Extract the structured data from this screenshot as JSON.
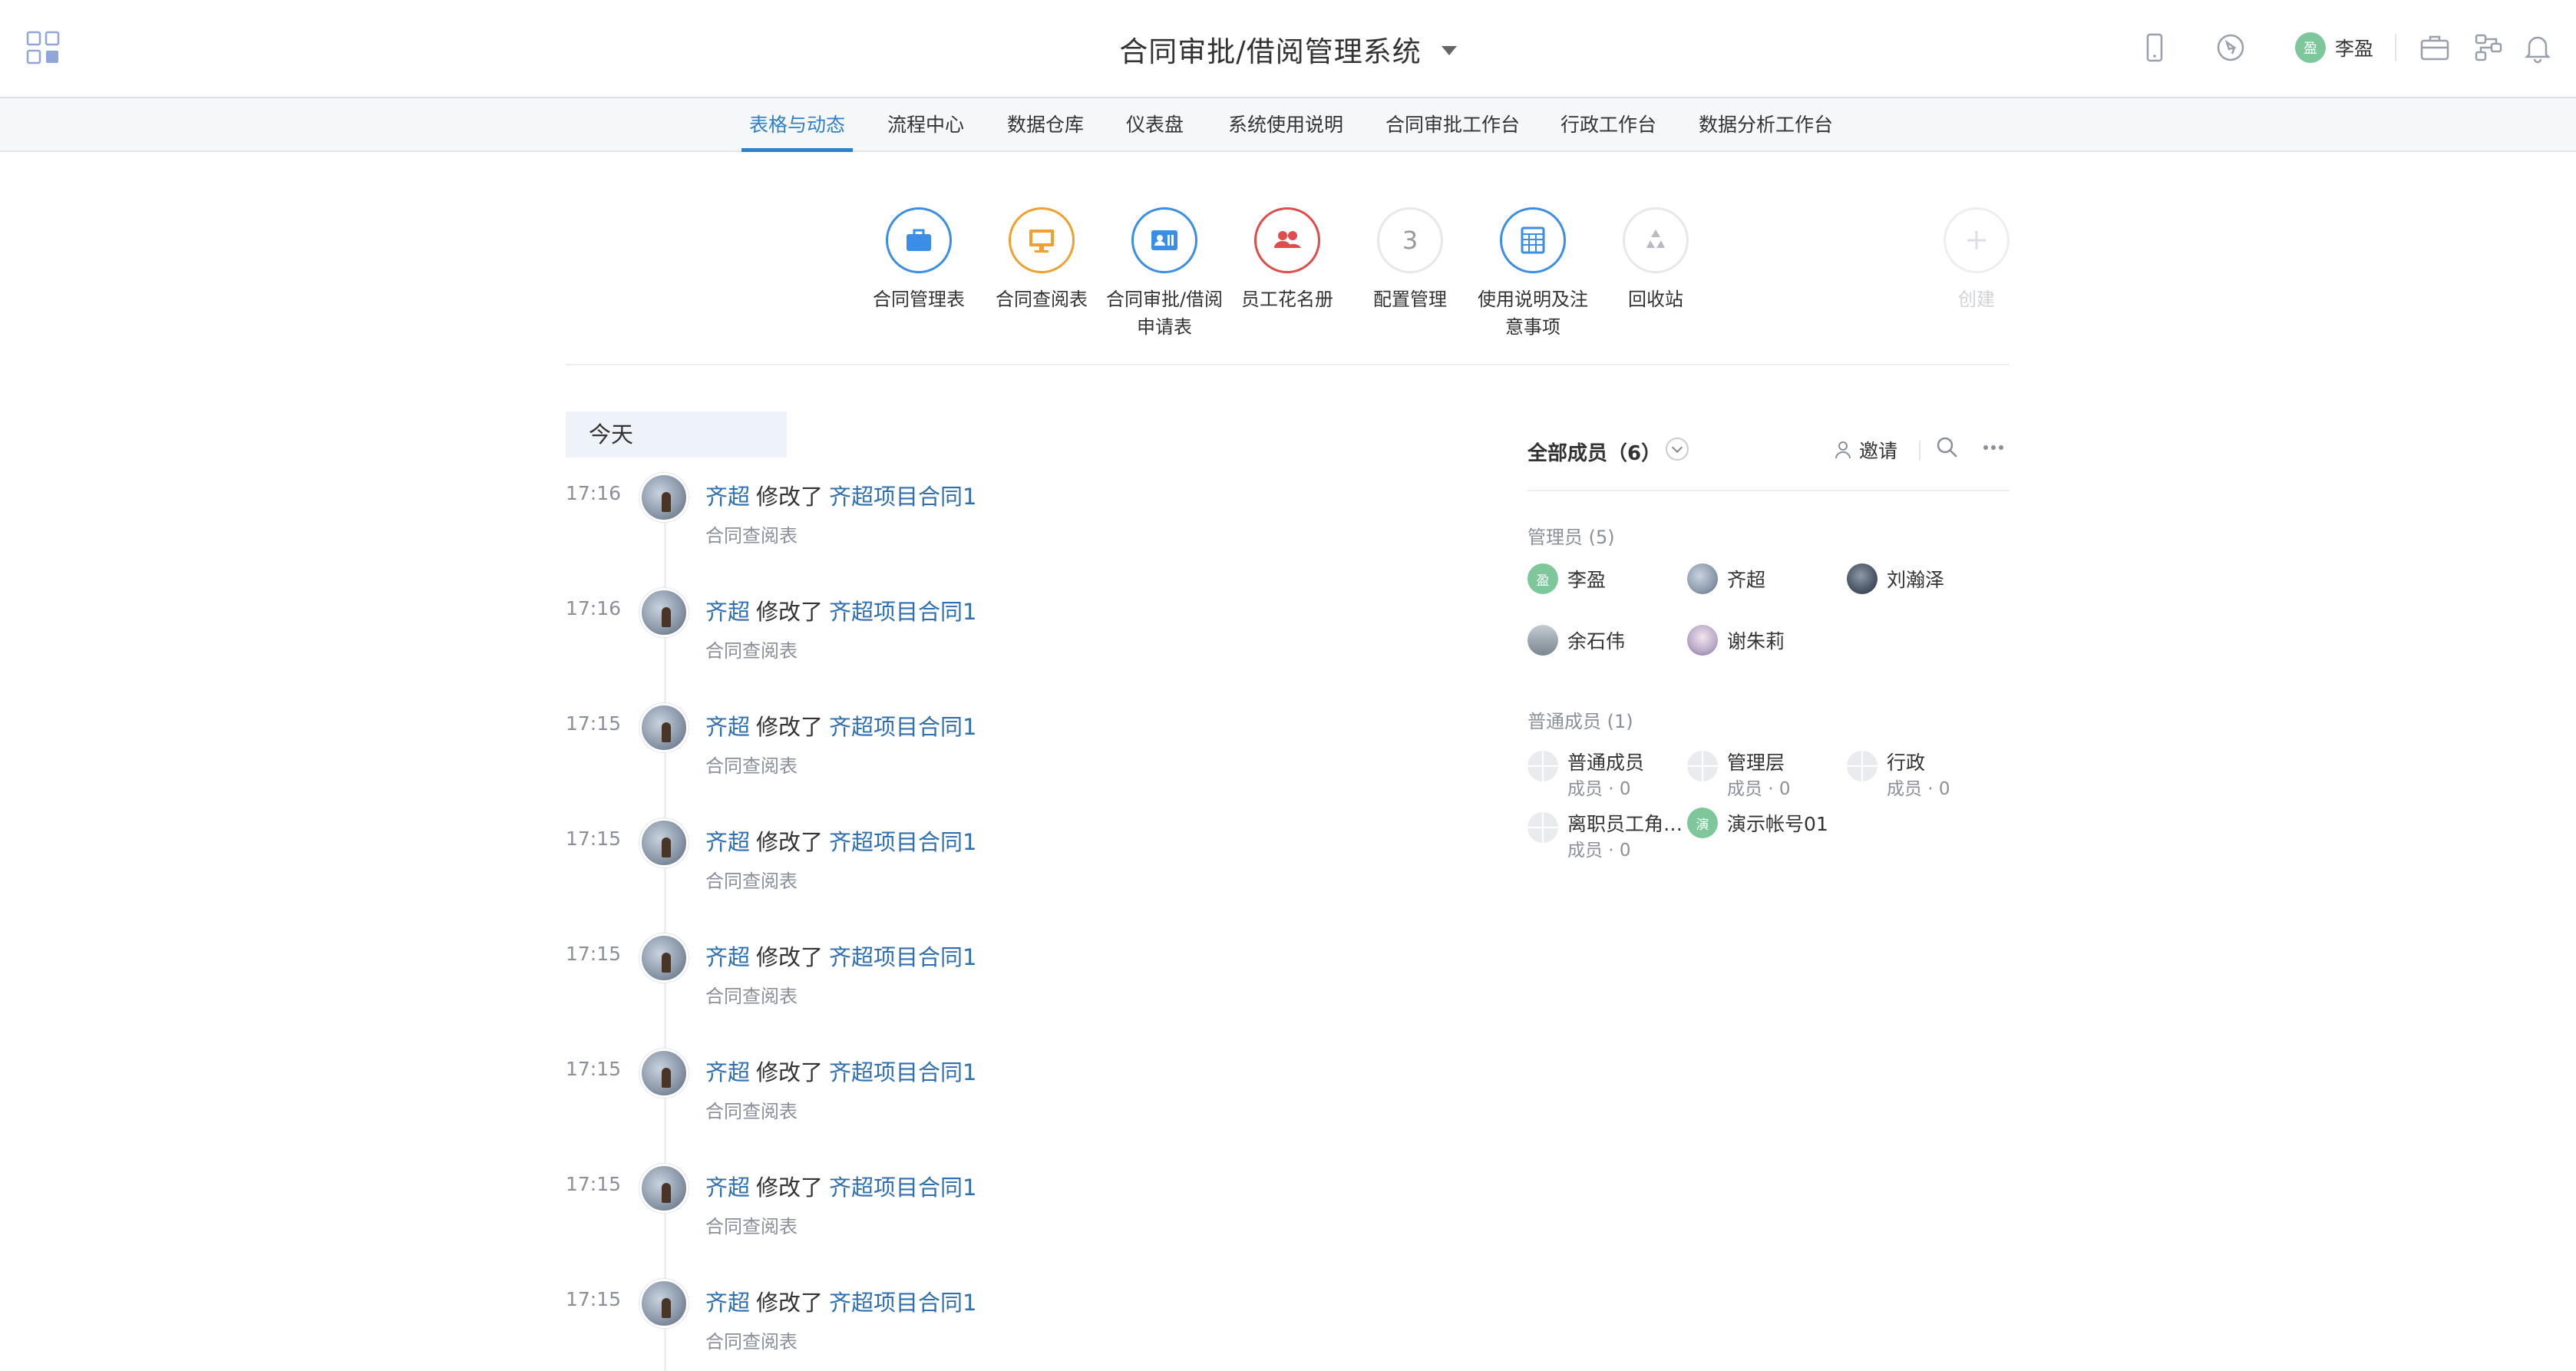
{
  "header": {
    "title": "合同审批/借阅管理系统",
    "user": {
      "name": "李盈",
      "avatar_text": "盈"
    },
    "icons": [
      "apps-grid-icon",
      "mobile-icon",
      "compass-icon",
      "briefcase-icon",
      "workflow-icon",
      "bell-icon"
    ]
  },
  "nav": {
    "tabs": [
      {
        "label": "表格与动态",
        "active": true
      },
      {
        "label": "流程中心"
      },
      {
        "label": "数据仓库"
      },
      {
        "label": "仪表盘"
      },
      {
        "label": "系统使用说明"
      },
      {
        "label": "合同审批工作台"
      },
      {
        "label": "行政工作台"
      },
      {
        "label": "数据分析工作台"
      }
    ]
  },
  "apps": [
    {
      "label": "合同管理表",
      "icon": "briefcase-icon",
      "color": "#3a8ee6"
    },
    {
      "label": "合同查阅表",
      "icon": "monitor-icon",
      "color": "#f0a030"
    },
    {
      "label_line1": "合同审批/借阅",
      "label_line2": "申请表",
      "icon": "id-card-icon",
      "color": "#3a8ee6"
    },
    {
      "label": "员工花名册",
      "icon": "people-icon",
      "color": "#e04b4b"
    },
    {
      "label": "配置管理",
      "icon_text": "3",
      "color": "#999999"
    },
    {
      "label_line1": "使用说明及注",
      "label_line2": "意事项",
      "icon": "table-icon",
      "color": "#3a8ee6"
    },
    {
      "label": "回收站",
      "icon": "recycle-icon",
      "color": "#bbbbbb"
    },
    {
      "label": "创建",
      "icon": "plus-icon",
      "color": "#dddddd"
    }
  ],
  "feed": {
    "day_label": "今天",
    "items": [
      {
        "time": "17:16",
        "user": "齐超",
        "verb": "修改了",
        "record": "齐超项目合同1",
        "source": "合同查阅表"
      },
      {
        "time": "17:16",
        "user": "齐超",
        "verb": "修改了",
        "record": "齐超项目合同1",
        "source": "合同查阅表"
      },
      {
        "time": "17:15",
        "user": "齐超",
        "verb": "修改了",
        "record": "齐超项目合同1",
        "source": "合同查阅表"
      },
      {
        "time": "17:15",
        "user": "齐超",
        "verb": "修改了",
        "record": "齐超项目合同1",
        "source": "合同查阅表"
      },
      {
        "time": "17:15",
        "user": "齐超",
        "verb": "修改了",
        "record": "齐超项目合同1",
        "source": "合同查阅表"
      },
      {
        "time": "17:15",
        "user": "齐超",
        "verb": "修改了",
        "record": "齐超项目合同1",
        "source": "合同查阅表"
      },
      {
        "time": "17:15",
        "user": "齐超",
        "verb": "修改了",
        "record": "齐超项目合同1",
        "source": "合同查阅表"
      },
      {
        "time": "17:15",
        "user": "齐超",
        "verb": "修改了",
        "record": "齐超项目合同1",
        "source": "合同查阅表"
      }
    ]
  },
  "members": {
    "title": "全部成员（6）",
    "invite_label": "邀请",
    "admins_title": "管理员 (5)",
    "admins": [
      {
        "name": "李盈",
        "avatar_text": "盈",
        "avatar_color": "#7dc79a"
      },
      {
        "name": "齐超",
        "avatar_color": "#8c9aab"
      },
      {
        "name": "刘瀚泽",
        "avatar_color": "#4a5566"
      },
      {
        "name": "余石伟",
        "avatar_color": "#9aa4ad"
      },
      {
        "name": "谢朱莉",
        "avatar_color": "#b8a9c9"
      }
    ],
    "regular_title": "普通成员 (1)",
    "roles": [
      {
        "name": "普通成员",
        "count": "成员 · 0"
      },
      {
        "name": "管理层",
        "count": "成员 · 0"
      },
      {
        "name": "行政",
        "count": "成员 · 0"
      },
      {
        "name": "离职员工角…",
        "count": "成员 · 0"
      }
    ],
    "regular_member": {
      "name": "演示帐号01",
      "avatar_text": "演",
      "avatar_color": "#7dc79a"
    }
  }
}
